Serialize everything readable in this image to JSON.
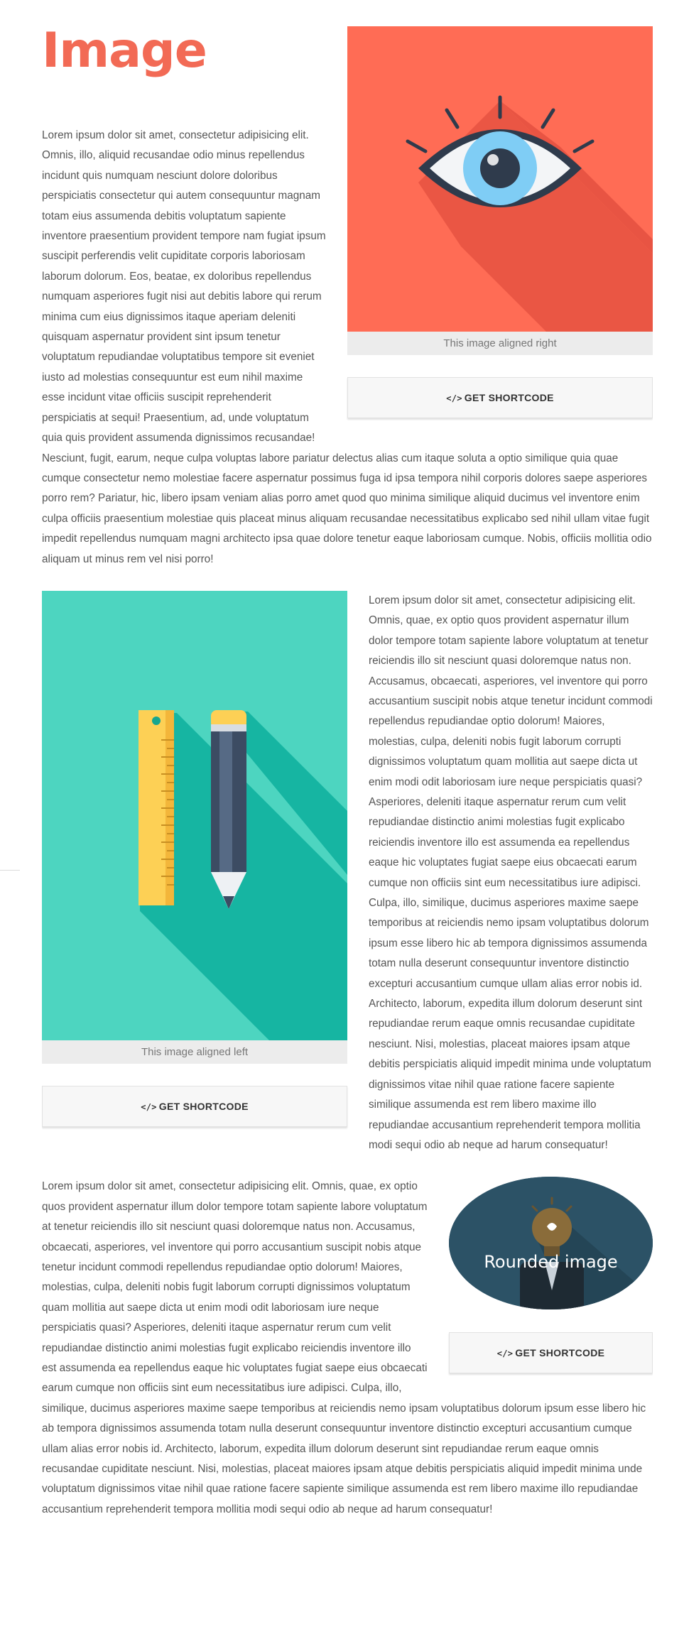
{
  "page": {
    "title": "Image"
  },
  "section1": {
    "caption": "This image aligned right",
    "button_label": "GET SHORTCODE",
    "button_icon": "code-icon",
    "image_colors": {
      "background": "#ff6c55",
      "shadow": "#e85443",
      "iris": "#7fcdf5",
      "outline": "#2f3b4c"
    },
    "text": "Lorem ipsum dolor sit amet, consectetur adipisicing elit. Omnis, illo, aliquid recusandae odio minus repellendus incidunt quis numquam nesciunt dolore doloribus perspiciatis consectetur qui autem consequuntur magnam totam eius assumenda debitis voluptatum sapiente inventore praesentium provident tempore nam fugiat ipsum suscipit perferendis velit cupiditate corporis laboriosam laborum dolorum. Eos, beatae, ex doloribus repellendus numquam asperiores fugit nisi aut debitis labore qui rerum minima cum eius dignissimos itaque aperiam deleniti quisquam aspernatur provident sint ipsum tenetur voluptatum repudiandae voluptatibus tempore sit eveniet iusto ad molestias consequuntur est eum nihil maxime esse incidunt vitae officiis suscipit reprehenderit perspiciatis at sequi! Praesentium, ad, unde voluptatum quia quis provident assumenda dignissimos recusandae! Nesciunt, fugit, earum, neque culpa voluptas labore pariatur delectus alias cum itaque soluta a optio similique quia quae cumque consectetur nemo molestiae facere aspernatur possimus fuga id ipsa tempora nihil corporis dolores saepe asperiores porro rem? Pariatur, hic, libero ipsam veniam alias porro amet quod quo minima similique aliquid ducimus vel inventore enim culpa officiis praesentium molestiae quis placeat minus aliquam recusandae necessitatibus explicabo sed nihil ullam vitae fugit impedit repellendus numquam magni architecto ipsa quae dolore tenetur eaque laboriosam cumque. Nobis, officiis mollitia odio aliquam ut minus rem vel nisi porro!"
  },
  "section2": {
    "caption": "This image aligned left",
    "button_label": "GET SHORTCODE",
    "button_icon": "code-icon",
    "image_colors": {
      "background": "#4dd5c0",
      "shadow": "#16b5a2",
      "ruler": "#fdd055",
      "pencil": "#3c4c63"
    },
    "text": "Lorem ipsum dolor sit amet, consectetur adipisicing elit. Omnis, quae, ex optio quos provident aspernatur illum dolor tempore totam sapiente labore voluptatum at tenetur reiciendis illo sit nesciunt quasi doloremque natus non. Accusamus, obcaecati, asperiores, vel inventore qui porro accusantium suscipit nobis atque tenetur incidunt commodi repellendus repudiandae optio dolorum! Maiores, molestias, culpa, deleniti nobis fugit laborum corrupti dignissimos voluptatum quam mollitia aut saepe dicta ut enim modi odit laboriosam iure neque perspiciatis quasi? Asperiores, deleniti itaque aspernatur rerum cum velit repudiandae distinctio animi molestias fugit explicabo reiciendis inventore illo est assumenda ea repellendus eaque hic voluptates fugiat saepe eius obcaecati earum cumque non officiis sint eum necessitatibus iure adipisci. Culpa, illo, similique, ducimus asperiores maxime saepe temporibus at reiciendis nemo ipsam voluptatibus dolorum ipsum esse libero hic ab tempora dignissimos assumenda totam nulla deserunt consequuntur inventore distinctio excepturi accusantium cumque ullam alias error nobis id. Architecto, laborum, expedita illum dolorum deserunt sint repudiandae rerum eaque omnis recusandae cupiditate nesciunt. Nisi, molestias, placeat maiores ipsam atque debitis perspiciatis aliquid impedit minima unde voluptatum dignissimos vitae nihil quae ratione facere sapiente similique assumenda est rem libero maxime illo repudiandae accusantium reprehenderit tempora mollitia modi sequi odio ab neque ad harum consequatur!"
  },
  "section3": {
    "overlay_label": "Rounded image",
    "button_label": "GET SHORTCODE",
    "button_icon": "code-icon",
    "image_colors": {
      "background": "#2c5266",
      "bulb": "#8a6c3a",
      "suit": "#1e2a33"
    },
    "text": "Lorem ipsum dolor sit amet, consectetur adipisicing elit. Omnis, quae, ex optio quos provident aspernatur illum dolor tempore totam sapiente labore voluptatum at tenetur reiciendis illo sit nesciunt quasi doloremque natus non. Accusamus, obcaecati, asperiores, vel inventore qui porro accusantium suscipit nobis atque tenetur incidunt commodi repellendus repudiandae optio dolorum! Maiores, molestias, culpa, deleniti nobis fugit laborum corrupti dignissimos voluptatum quam mollitia aut saepe dicta ut enim modi odit laboriosam iure neque perspiciatis quasi? Asperiores, deleniti itaque aspernatur rerum cum velit repudiandae distinctio animi molestias fugit explicabo reiciendis inventore illo est assumenda ea repellendus eaque hic voluptates fugiat saepe eius obcaecati earum cumque non officiis sint eum necessitatibus iure adipisci. Culpa, illo, similique, ducimus asperiores maxime saepe temporibus at reiciendis nemo ipsam voluptatibus dolorum ipsum esse libero hic ab tempora dignissimos assumenda totam nulla deserunt consequuntur inventore distinctio excepturi accusantium cumque ullam alias error nobis id. Architecto, laborum, expedita illum dolorum deserunt sint repudiandae rerum eaque omnis recusandae cupiditate nesciunt. Nisi, molestias, placeat maiores ipsam atque debitis perspiciatis aliquid impedit minima unde voluptatum dignissimos vitae nihil quae ratione facere sapiente similique assumenda est rem libero maxime illo repudiandae accusantium reprehenderit tempora mollitia modi sequi odio ab neque ad harum consequatur!"
  }
}
